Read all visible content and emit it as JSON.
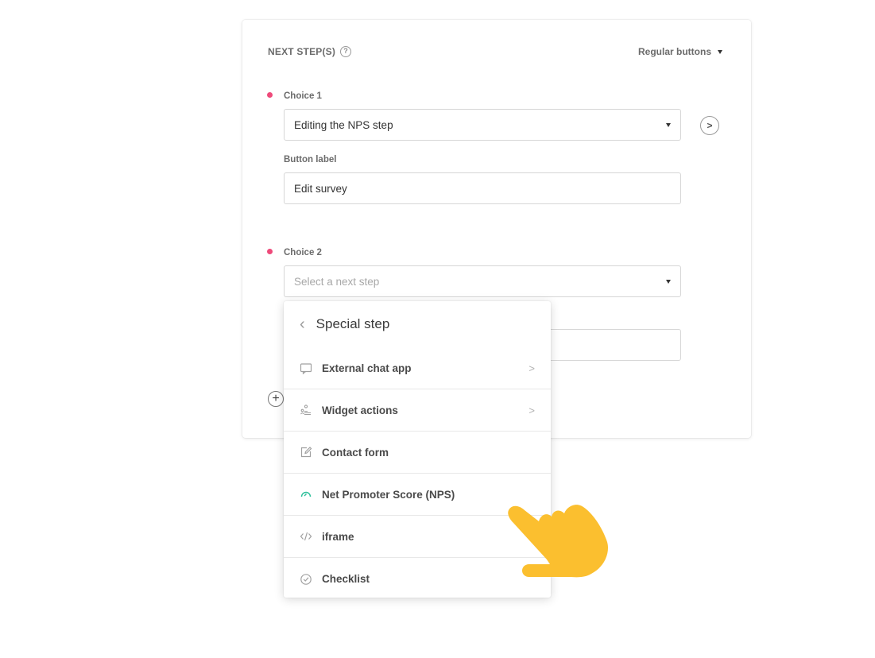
{
  "section": {
    "title": "NEXT STEP(S)",
    "help_glyph": "?",
    "mode": "Regular buttons"
  },
  "choices": [
    {
      "label": "Choice 1",
      "value": "Editing the NPS step",
      "button_label_title": "Button label",
      "button_label_value": "Edit survey"
    },
    {
      "label": "Choice 2",
      "placeholder": "Select a next step"
    }
  ],
  "dropdown": {
    "header": "Special step",
    "items": [
      {
        "label": "External chat app",
        "icon": "chat-bubble-icon",
        "has_submenu": true
      },
      {
        "label": "Widget actions",
        "icon": "widget-people-icon",
        "has_submenu": true
      },
      {
        "label": "Contact form",
        "icon": "edit-form-icon",
        "has_submenu": false
      },
      {
        "label": "Net Promoter Score (NPS)",
        "icon": "gauge-icon",
        "has_submenu": false
      },
      {
        "label": "iframe",
        "icon": "code-icon",
        "has_submenu": false
      },
      {
        "label": "Checklist",
        "icon": "check-circle-icon",
        "has_submenu": false
      }
    ]
  },
  "colors": {
    "required_dot": "#ee4a7a",
    "nps_icon": "#2cbf9a",
    "hand": "#fbbf2f"
  }
}
